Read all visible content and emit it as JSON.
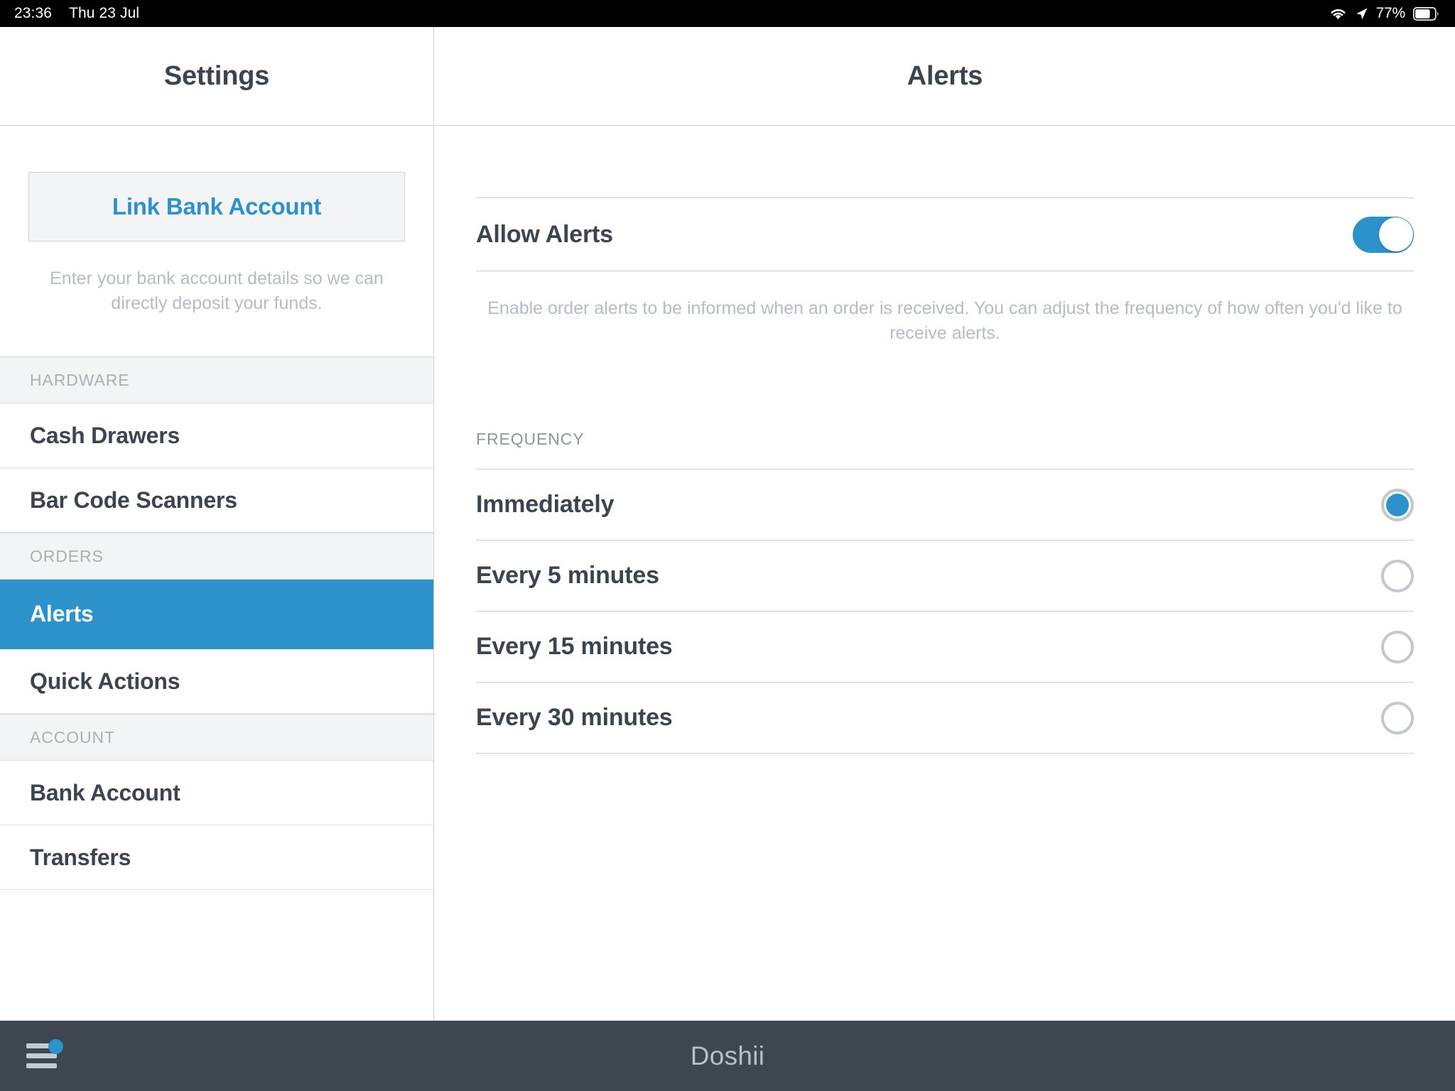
{
  "status_bar": {
    "time": "23:36",
    "date": "Thu 23 Jul",
    "battery_percent": "77%",
    "icons": [
      "wifi-icon",
      "location-arrow-icon",
      "battery-icon"
    ]
  },
  "sidebar": {
    "title": "Settings",
    "link_bank_button": {
      "label": "Link Bank Account",
      "description": "Enter your bank account details so we can directly deposit your funds."
    },
    "sections": [
      {
        "header": "HARDWARE",
        "items": [
          {
            "label": "Cash Drawers",
            "selected": false
          },
          {
            "label": "Bar Code Scanners",
            "selected": false
          }
        ]
      },
      {
        "header": "ORDERS",
        "items": [
          {
            "label": "Alerts",
            "selected": true
          },
          {
            "label": "Quick Actions",
            "selected": false
          }
        ]
      },
      {
        "header": "ACCOUNT",
        "items": [
          {
            "label": "Bank Account",
            "selected": false
          },
          {
            "label": "Transfers",
            "selected": false
          }
        ]
      }
    ]
  },
  "detail": {
    "title": "Alerts",
    "allow_alerts": {
      "label": "Allow Alerts",
      "enabled": true,
      "help_text": "Enable order alerts to be informed when an order is received. You can adjust the frequency of how often you'd like to receive alerts."
    },
    "frequency": {
      "header": "FREQUENCY",
      "selected": "Immediately",
      "options": [
        {
          "label": "Immediately",
          "selected": true
        },
        {
          "label": "Every 5 minutes",
          "selected": false
        },
        {
          "label": "Every 15 minutes",
          "selected": false
        },
        {
          "label": "Every 30 minutes",
          "selected": false
        }
      ]
    }
  },
  "bottom_bar": {
    "brand": "Doshii",
    "menu_icon": "hamburger-menu-icon",
    "has_notification_dot": true
  },
  "colors": {
    "accent_blue": "#2e92ca",
    "text_dark": "#3c4450",
    "text_muted": "#b5bcc3",
    "section_bg": "#f2f4f5",
    "bottom_bar_bg": "#3e4650",
    "divider": "#c9d0d6"
  }
}
